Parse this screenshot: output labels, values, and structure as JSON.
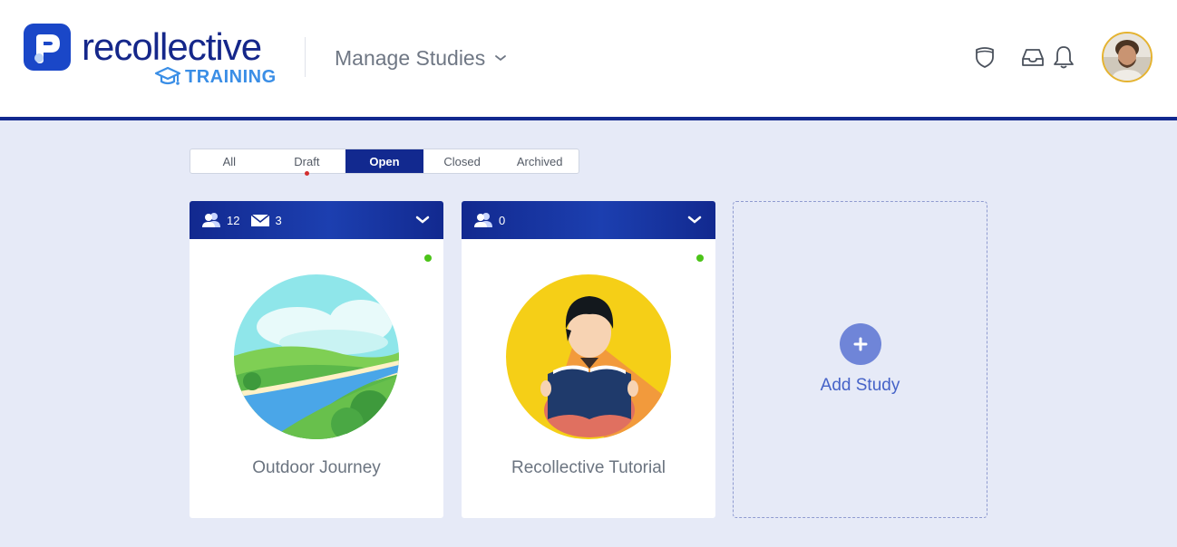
{
  "brand": {
    "name": "recollective",
    "subtitle": "TRAINING",
    "primary_color": "#12298f",
    "accent_color": "#3a8ee6"
  },
  "header": {
    "menu_label": "Manage Studies",
    "icons": [
      "shield-icon",
      "inbox-icon",
      "bell-icon",
      "user-avatar"
    ]
  },
  "filters": {
    "tabs": [
      {
        "label": "All",
        "active": false
      },
      {
        "label": "Draft",
        "active": false,
        "has_indicator": true
      },
      {
        "label": "Open",
        "active": true
      },
      {
        "label": "Closed",
        "active": false
      },
      {
        "label": "Archived",
        "active": false
      }
    ]
  },
  "studies": [
    {
      "title": "Outdoor Journey",
      "participants": "12",
      "messages": "3",
      "status_color": "#4cc419",
      "image": "landscape-illustration"
    },
    {
      "title": "Recollective Tutorial",
      "participants": "0",
      "status_color": "#4cc419",
      "image": "reader-illustration"
    }
  ],
  "add_study": {
    "label": "Add Study"
  }
}
